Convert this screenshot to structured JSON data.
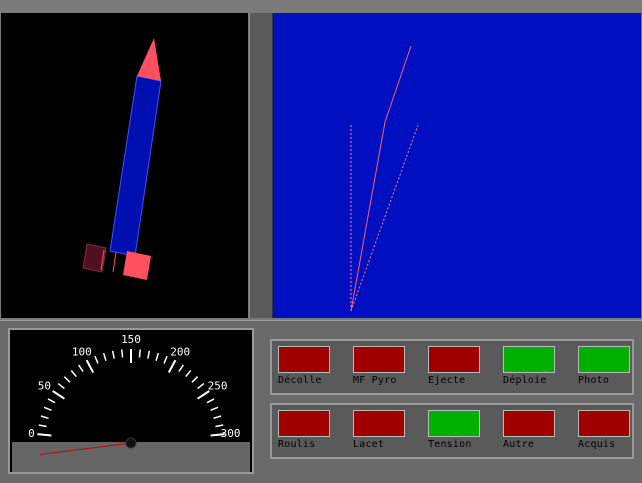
{
  "gauge": {
    "ticks": [
      "0",
      "50",
      "100",
      "150",
      "200",
      "250",
      "300"
    ],
    "needle_value": 0
  },
  "indicators_top": [
    {
      "label": "Décolle",
      "state": "red"
    },
    {
      "label": "MF Pyro",
      "state": "red"
    },
    {
      "label": "Ejecte",
      "state": "red"
    },
    {
      "label": "Déploie",
      "state": "green"
    },
    {
      "label": "Photo",
      "state": "green"
    }
  ],
  "indicators_bottom": [
    {
      "label": "Roulis",
      "state": "red"
    },
    {
      "label": "Lacet",
      "state": "red"
    },
    {
      "label": "Tension",
      "state": "green"
    },
    {
      "label": "Autre",
      "state": "red"
    },
    {
      "label": "Acquis",
      "state": "red"
    }
  ],
  "colors": {
    "rocket_body": "#0010b0",
    "rocket_tip": "#ff5060",
    "trajectory_bg": "#0010c0",
    "trajectory_line": "#ff6070",
    "lamp_red": "#a00000",
    "lamp_green": "#00b000"
  }
}
